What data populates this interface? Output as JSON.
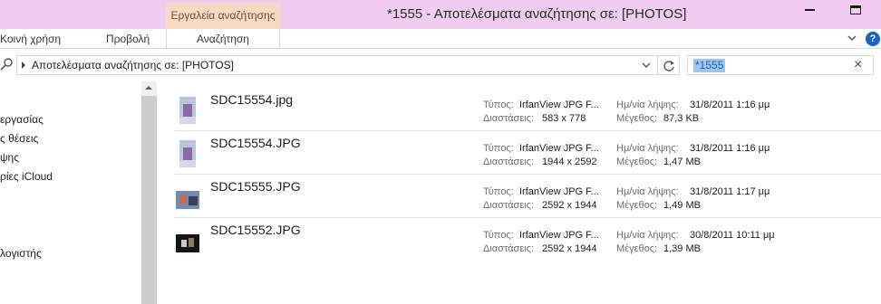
{
  "window": {
    "title": "*1555 - Αποτελέσματα αναζήτησης σε: [PHOTOS]",
    "context_tab": "Εργαλεία αναζήτησης"
  },
  "ribbon": {
    "tabs": [
      "Κοινή χρήση",
      "Προβολή",
      "Αναζήτηση"
    ],
    "help_label": "?"
  },
  "address": {
    "path": "Αποτελέσματα αναζήτησης σε: [PHOTOS]"
  },
  "search": {
    "query": "*1555",
    "clear_glyph": "×"
  },
  "nav": {
    "items": [
      "εργασίας",
      "ς θέσεις",
      "ψης",
      "ρίες iCloud",
      "λογιστής"
    ]
  },
  "labels": {
    "type": "Τύπος:",
    "dimensions": "Διαστάσεις:",
    "date_taken": "Ημ/νία λήψης:",
    "size": "Μέγεθος:"
  },
  "results": [
    {
      "name": "SDC15554.jpg",
      "type": "IrfanView JPG F...",
      "dimensions": "583 x 778",
      "date_taken": "31/8/2011 1:16 μμ",
      "size": "87,3 KB",
      "thumb": "portrait"
    },
    {
      "name": "SDC15554.JPG",
      "type": "IrfanView JPG F...",
      "dimensions": "1944 x 2592",
      "date_taken": "31/8/2011 1:16 μμ",
      "size": "1,47 MB",
      "thumb": "portrait"
    },
    {
      "name": "SDC15555.JPG",
      "type": "IrfanView JPG F...",
      "dimensions": "2592 x 1944",
      "date_taken": "31/8/2011 1:17 μμ",
      "size": "1,49 MB",
      "thumb": "landscape"
    },
    {
      "name": "SDC15552.JPG",
      "type": "IrfanView JPG F...",
      "dimensions": "2592 x 1944",
      "date_taken": "30/8/2011 10:11 μμ",
      "size": "1,39 MB",
      "thumb": "dark"
    }
  ],
  "colors": {
    "titlebar": "#f2ccf0",
    "context_tab": "#f8d9c4",
    "selection": "#99c6f3",
    "help": "#1b64c6"
  }
}
